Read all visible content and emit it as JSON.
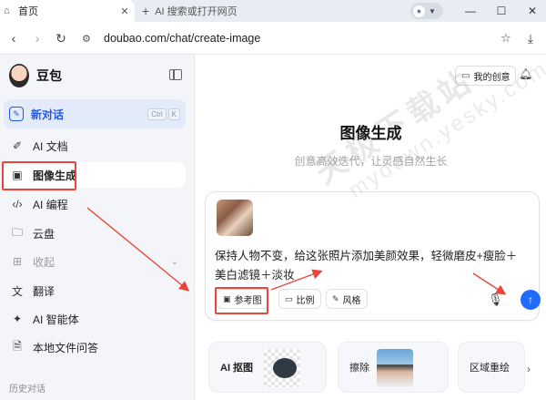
{
  "browser": {
    "active_tab_label": "首页",
    "new_tab_label": "AI 搜索或打开网页",
    "url_host": "doubao.com",
    "url_path": "/chat/create-image"
  },
  "sidebar": {
    "brand_name": "豆包",
    "new_chat_label": "新对话",
    "new_chat_shortcut": [
      "Ctrl",
      "K"
    ],
    "items": [
      {
        "label": "AI 文档"
      },
      {
        "label": "图像生成"
      },
      {
        "label": "AI 编程"
      },
      {
        "label": "云盘"
      },
      {
        "label": "收起"
      },
      {
        "label": "翻译"
      },
      {
        "label": "AI 智能体"
      },
      {
        "label": "本地文件问答"
      }
    ],
    "history_label": "历史对话"
  },
  "main": {
    "my_creative_label": "我的创意",
    "title": "图像生成",
    "subtitle": "创意高效迭代，让灵感自然生长",
    "prompt_text": "保持人物不变，给这张照片添加美颜效果，轻微磨皮+瘦脸＋美白滤镜＋淡妆",
    "chips": [
      {
        "label": "参考图"
      },
      {
        "label": "比例"
      },
      {
        "label": "风格"
      }
    ],
    "cards": [
      {
        "label": "AI 抠图"
      },
      {
        "label": "擦除"
      },
      {
        "label": "区域重绘"
      }
    ]
  },
  "watermark": {
    "line1": "天极下载站",
    "line2": "mydown.yesky.com"
  },
  "colors": {
    "accent": "#2458e6",
    "send": "#1f6bff",
    "annotation": "#e8453c"
  }
}
